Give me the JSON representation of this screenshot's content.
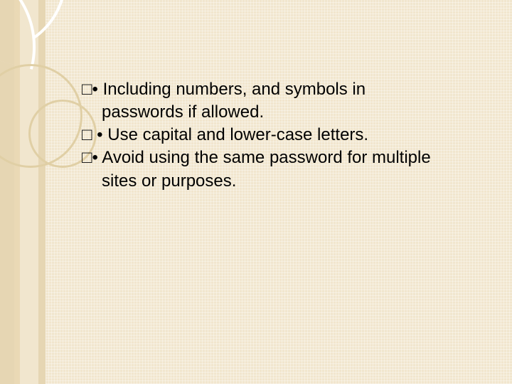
{
  "bullets": [
    {
      "marker": "□•",
      "text": " Including numbers, and symbols in passwords if allowed."
    },
    {
      "marker": "□ •",
      "text": " Use capital and lower-case letters."
    },
    {
      "marker": "□•",
      "text": " Avoid using the same password for multiple sites or purposes."
    }
  ]
}
